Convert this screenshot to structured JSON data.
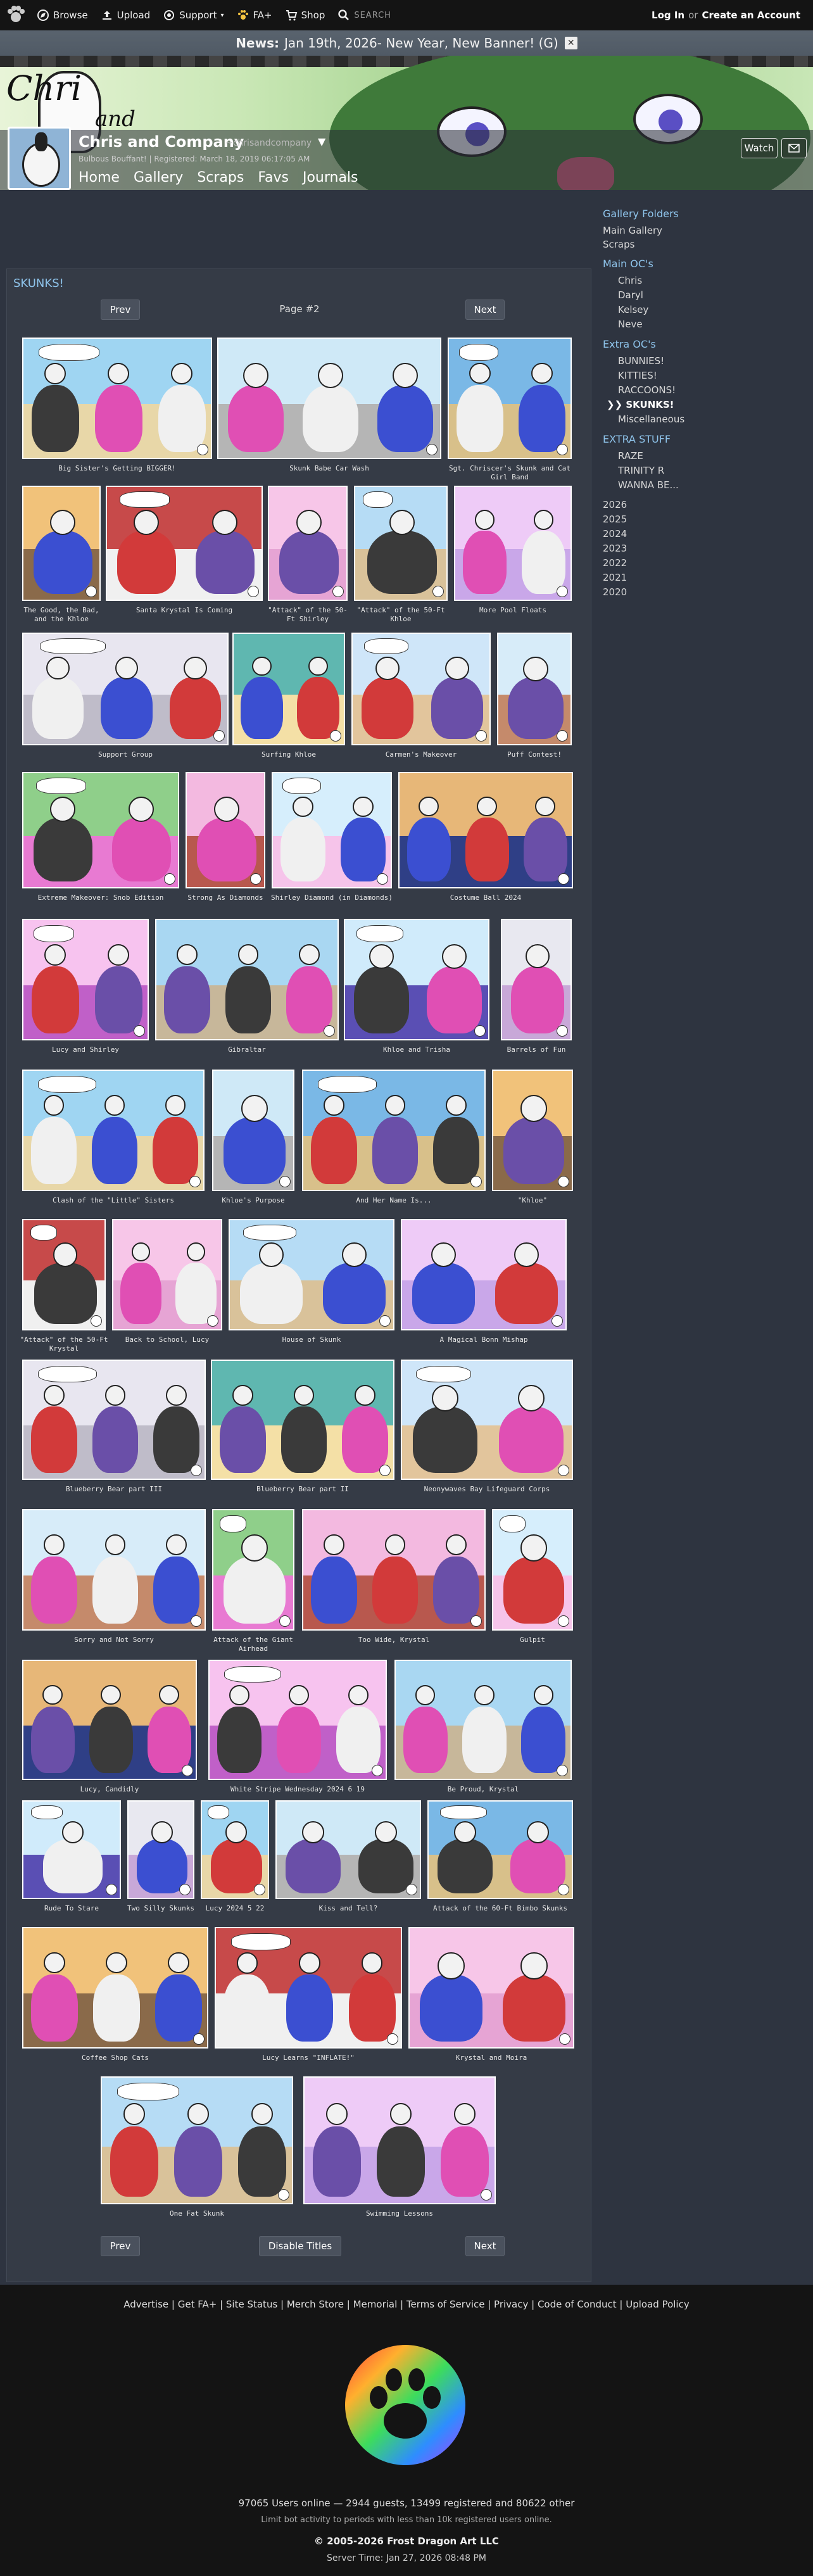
{
  "topnav": {
    "browse": "Browse",
    "upload": "Upload",
    "support": "Support",
    "fa_plus": "FA+",
    "shop": "Shop",
    "search": "SEARCH",
    "login": "Log In",
    "or": "or",
    "create": "Create an Account"
  },
  "news": {
    "label": "News:",
    "text": "Jan 19th, 2026- New Year, New Banner! (G)",
    "close": "✕"
  },
  "banner": {
    "logo_line1": "Chri",
    "logo_line2": "and"
  },
  "profile": {
    "name": "Chris and Company",
    "handle": "~chrisandcompany",
    "subinfo": "Bulbous Bouffant! | Registered: March 18, 2019 06:17:05 AM",
    "watch": "Watch",
    "tabs": [
      "Home",
      "Gallery",
      "Scraps",
      "Favs",
      "Journals"
    ]
  },
  "sidebar": {
    "gallery_folders": "Gallery Folders",
    "main_gallery": "Main Gallery",
    "scraps": "Scraps",
    "main_ocs": "Main OC's",
    "main_oc_items": [
      "Chris",
      "Daryl",
      "Kelsey",
      "Neve"
    ],
    "extra_ocs": "Extra OC's",
    "extra_oc_items": [
      "BUNNIES!",
      "KITTIES!",
      "RACCOONS!",
      "❯❯ SKUNKS!",
      "Miscellaneous"
    ],
    "extra_stuff": "EXTRA STUFF",
    "extra_stuff_items": [
      "RAZE",
      "TRINITY R",
      "WANNA BE..."
    ],
    "years": [
      "2026",
      "2025",
      "2024",
      "2023",
      "2022",
      "2021",
      "2020"
    ]
  },
  "gallery": {
    "title": "SKUNKS!",
    "prev": "Prev",
    "next": "Next",
    "page": "Page #2",
    "disable_titles": "Disable Titles",
    "items": [
      "Big Sister's Getting BIGGER!",
      "Skunk Babe Car Wash",
      "Sgt. Chriscer's Skunk and Cat Girl Band",
      "The Good, the Bad, and the Khloe",
      "Santa Krystal Is Coming",
      "\"Attack\" of the 50-Ft Shirley",
      "\"Attack\" of the 50-Ft Khloe",
      "More Pool Floats",
      "Support Group",
      "Surfing Khloe",
      "Carmen's Makeover",
      "Puff Contest!",
      "Extreme Makeover: Snob Edition",
      "Strong As Diamonds",
      "Shirley Diamond (in Diamonds)",
      "Costume Ball 2024",
      "Lucy and Shirley",
      "Gibraltar",
      "Khloe and Trisha",
      "Barrels of Fun",
      "Clash of the \"Little\" Sisters",
      "Khloe's Purpose",
      "And Her Name Is...",
      "\"Khloe\"",
      "\"Attack\" of the 50-Ft Krystal",
      "Back to School, Lucy",
      "House of Skunk",
      "A Magical Bonn Mishap",
      "Blueberry Bear part III",
      "Blueberry Bear part II",
      "Neonywaves Bay Lifeguard Corps",
      "Sorry and Not Sorry",
      "Attack of the Giant Airhead",
      "Too Wide, Krystal",
      "Gulpit",
      "Lucy, Candidly",
      "White Stripe Wednesday 2024 6 19",
      "Be Proud, Krystal",
      "Rude To Stare",
      "Two Silly Skunks",
      "Lucy 2024 5 22",
      "Kiss and Tell?",
      "Attack of the 60-Ft Bimbo Skunks",
      "Coffee Shop Cats",
      "Lucy Learns \"INFLATE!\"",
      "Krystal and Moira",
      "One Fat Skunk",
      "Swimming Lessons"
    ]
  },
  "footer": {
    "links": "Advertise | Get FA+ | Site Status | Merch Store | Memorial | Terms of Service | Privacy | Code of Conduct | Upload Policy",
    "online": "97065 Users online — 2944 guests, 13499 registered and 80622 other",
    "limit": "Limit bot activity to periods with less than 10k registered users online.",
    "copyright": "© 2005-2026 Frost Dragon Art LLC",
    "server_time": "Server Time: Jan 27, 2026 08:48 PM"
  },
  "colors": {
    "accent": "#8ec3ea",
    "background": "#2e3440",
    "panel": "#353b46",
    "topbar": "#141414"
  }
}
